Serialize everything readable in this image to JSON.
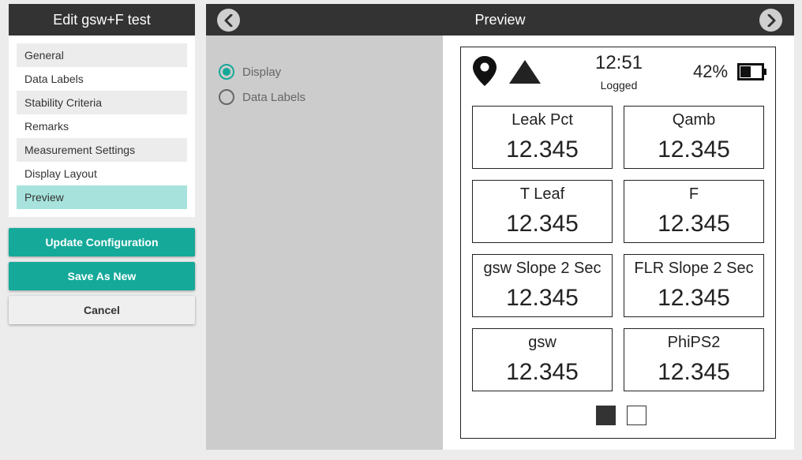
{
  "left": {
    "title": "Edit gsw+F test",
    "nav_items": [
      {
        "label": "General"
      },
      {
        "label": "Data Labels"
      },
      {
        "label": "Stability Criteria"
      },
      {
        "label": "Remarks"
      },
      {
        "label": "Measurement Settings"
      },
      {
        "label": "Display Layout"
      },
      {
        "label": "Preview",
        "selected": true
      }
    ],
    "buttons": {
      "update": "Update Configuration",
      "save_new": "Save As New",
      "cancel": "Cancel"
    }
  },
  "header": {
    "title": "Preview",
    "prev_icon": "chevron-left-icon",
    "next_icon": "chevron-right-icon"
  },
  "options": {
    "radios": [
      {
        "label": "Display",
        "checked": true
      },
      {
        "label": "Data Labels",
        "checked": false
      }
    ]
  },
  "device": {
    "status": {
      "time": "12:51",
      "logged": "Logged",
      "battery_pct": "42%",
      "icons": [
        "location-pin-icon",
        "triangle-icon",
        "battery-icon"
      ]
    },
    "tiles": [
      {
        "label": "Leak Pct",
        "value": "12.345"
      },
      {
        "label": "Qamb",
        "value": "12.345"
      },
      {
        "label": "T Leaf",
        "value": "12.345"
      },
      {
        "label": "F",
        "value": "12.345"
      },
      {
        "label": "gsw Slope 2 Sec",
        "value": "12.345"
      },
      {
        "label": "FLR Slope 2 Sec",
        "value": "12.345"
      },
      {
        "label": "gsw",
        "value": "12.345"
      },
      {
        "label": "PhiPS2",
        "value": "12.345"
      }
    ],
    "pages": {
      "count": 2,
      "active": 1
    }
  },
  "colors": {
    "accent": "#15a99a",
    "selected_nav": "#a7e3dc",
    "header_bg": "#333333"
  }
}
